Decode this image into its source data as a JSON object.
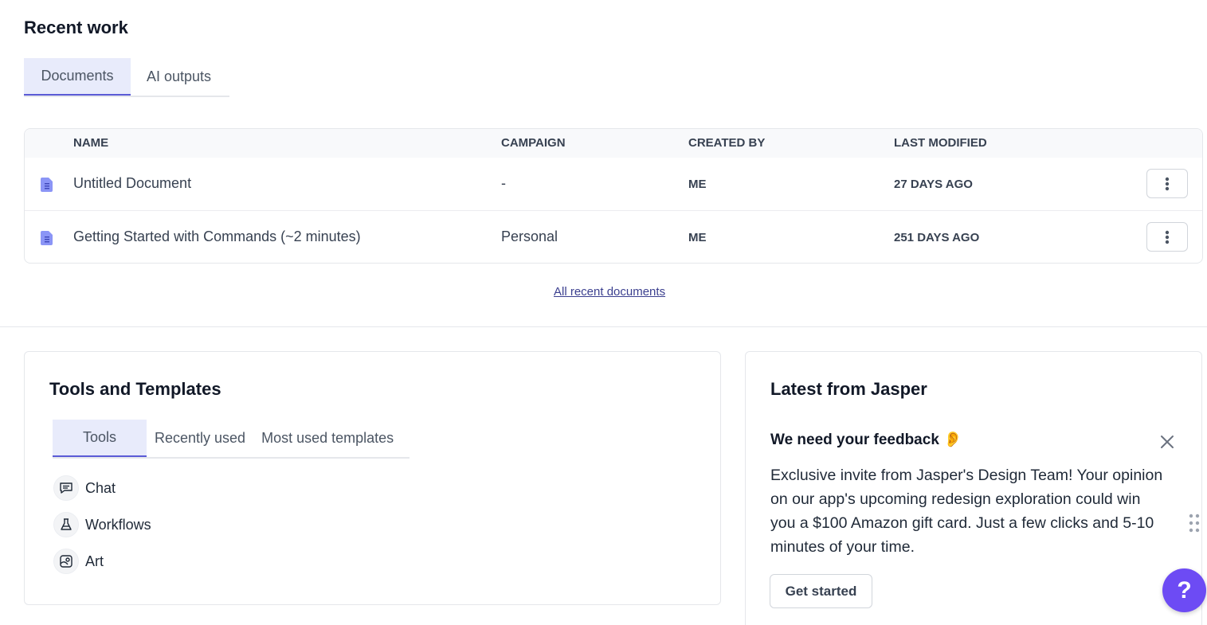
{
  "recent_work": {
    "title": "Recent work",
    "tabs": [
      {
        "label": "Documents",
        "active": true
      },
      {
        "label": "AI outputs",
        "active": false
      }
    ],
    "table": {
      "columns": [
        "NAME",
        "CAMPAIGN",
        "CREATED BY",
        "LAST MODIFIED"
      ],
      "rows": [
        {
          "name": "Untitled Document",
          "campaign": "-",
          "created_by": "ME",
          "last_modified": "27 DAYS AGO"
        },
        {
          "name": "Getting Started with Commands (~2 minutes)",
          "campaign": "Personal",
          "created_by": "ME",
          "last_modified": "251 DAYS AGO"
        }
      ]
    },
    "all_recent_link": "All recent documents"
  },
  "tools": {
    "title": "Tools and Templates",
    "tabs": [
      {
        "label": "Tools",
        "active": true
      },
      {
        "label": "Recently used",
        "active": false
      },
      {
        "label": "Most used templates",
        "active": false
      }
    ],
    "items": [
      {
        "label": "Chat",
        "icon": "chat-icon"
      },
      {
        "label": "Workflows",
        "icon": "flask-icon"
      },
      {
        "label": "Art",
        "icon": "image-icon"
      }
    ]
  },
  "latest": {
    "title": "Latest from Jasper",
    "feedback_title": "We need your feedback",
    "feedback_emoji": "👂",
    "feedback_body": "Exclusive invite from Jasper's Design Team! Your opinion on our app's upcoming redesign exploration could win you a $100 Amazon gift card. Just a few clicks and 5-10 minutes of your time.",
    "cta": "Get started"
  },
  "help": {
    "label": "?"
  },
  "colors": {
    "accent": "#5b5bd6",
    "tab_active_bg": "#e8ebfb",
    "help_bg": "#6d4bf4",
    "doc_icon": "#8b95f6"
  }
}
